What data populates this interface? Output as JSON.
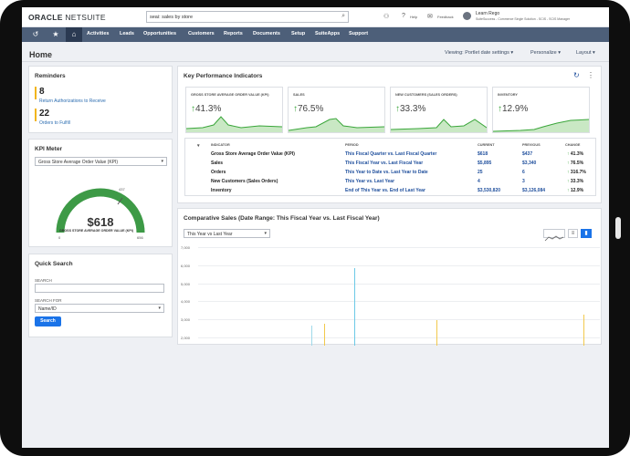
{
  "header": {
    "logo_bold": "ORACLE",
    "logo_thin": " NETSUITE",
    "search_value": "seai: sales by store",
    "help": "Help",
    "feedback": "Feedback",
    "user_name": "Learn Rego",
    "user_role": "SuiteSuccess - Commerce Single Solution - SCIS - SCIS Manager"
  },
  "nav": {
    "items": [
      "Activities",
      "Leads",
      "Opportunities",
      "Customers",
      "Reports",
      "Documents",
      "Setup",
      "SuiteApps",
      "Support"
    ]
  },
  "page": {
    "title": "Home",
    "viewing": "Viewing: Portlet date settings ▾",
    "personalize": "Personalize ▾",
    "layout": "Layout ▾"
  },
  "reminders": {
    "title": "Reminders",
    "items": [
      {
        "count": "8",
        "label": "Return Authorizations to Receive",
        "color": "#f2b51b"
      },
      {
        "count": "22",
        "label": "Orders to Fulfill",
        "color": "#f2b51b"
      }
    ]
  },
  "kpi_meter": {
    "title": "KPI Meter",
    "select": "Gross Store Average Order Value (KPI)",
    "value": "$618",
    "gauge_label": "GROSS STORE AVERAGE ORDER VALUE (KPI)",
    "min": "0",
    "max": "656",
    "target": "437"
  },
  "quick_search": {
    "title": "Quick Search",
    "search_label": "SEARCH",
    "search_for_label": "SEARCH FOR",
    "search_for_value": "Name/ID",
    "button": "Search"
  },
  "kpi": {
    "title": "Key Performance Indicators",
    "tiles": [
      {
        "label": "GROSS STORE AVERAGE ORDER VALUE (KPI)",
        "arrow": "↑",
        "value": "41.3%"
      },
      {
        "label": "SALES",
        "arrow": "↑",
        "value": "76.5%"
      },
      {
        "label": "NEW CUSTOMERS (SALES ORDERS)",
        "arrow": "↑",
        "value": "33.3%"
      },
      {
        "label": "INVENTORY",
        "arrow": "↑",
        "value": "12.9%"
      }
    ],
    "columns": {
      "indicator": "INDICATOR",
      "period": "PERIOD",
      "current": "CURRENT",
      "previous": "PREVIOUS",
      "change": "CHANGE"
    },
    "rows": [
      {
        "indicator": "Gross Store Average Order Value (KPI)",
        "period": "This Fiscal Quarter vs. Last Fiscal Quarter",
        "current": "$618",
        "previous": "$437",
        "change": "41.3%"
      },
      {
        "indicator": "Sales",
        "period": "This Fiscal Year vs. Last Fiscal Year",
        "current": "$5,895",
        "previous": "$3,340",
        "change": "76.5%"
      },
      {
        "indicator": "Orders",
        "period": "This Year to Date vs. Last Year to Date",
        "current": "25",
        "previous": "6",
        "change": "316.7%"
      },
      {
        "indicator": "New Customers (Sales Orders)",
        "period": "This Year vs. Last Year",
        "current": "4",
        "previous": "3",
        "change": "33.3%"
      },
      {
        "indicator": "Inventory",
        "period": "End of This Year vs. End of Last Year",
        "current": "$3,530,820",
        "previous": "$3,126,084",
        "change": "12.9%"
      }
    ]
  },
  "comparative": {
    "title": "Comparative Sales (Date Range: This Fiscal Year vs. Last Fiscal Year)",
    "select": "This Year vs Last Year",
    "yticks": [
      "7,000",
      "6,000",
      "5,000",
      "4,000",
      "3,000",
      "2,000"
    ]
  },
  "colors": {
    "nav": "#4d5f79",
    "accent": "#1a73e8",
    "positive": "#3aa63a",
    "series_this_year": "#6cc9e6",
    "series_last_year": "#f2c94c"
  }
}
